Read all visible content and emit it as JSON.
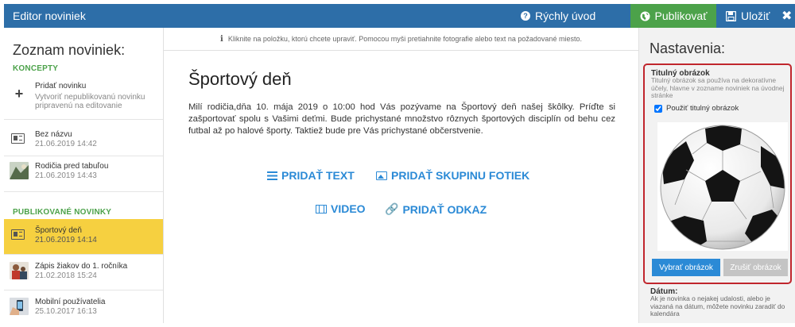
{
  "header": {
    "title": "Editor noviniek",
    "quick_start": "Rýchly úvod",
    "quick_start_icon": "?",
    "publish": "Publikovať",
    "save": "Uložiť",
    "close": "✖"
  },
  "sidebar": {
    "heading": "Zoznam noviniek:",
    "drafts_label": "KONCEPTY",
    "add_news": {
      "title": "Pridať novinku",
      "desc": "Vytvoriť nepublikovanú novinku pripravenú na editovanie"
    },
    "drafts": [
      {
        "title": "Bez názvu",
        "date": "21.06.2019 14:42",
        "icon": "news-icon"
      },
      {
        "title": "Rodičia pred tabuľou",
        "date": "21.06.2019 14:43",
        "icon": "photo-thumbnail"
      }
    ],
    "published_label": "PUBLIKOVANÉ NOVINKY",
    "published": [
      {
        "title": "Športový deň",
        "date": "21.06.2019 14:14",
        "icon": "news-icon",
        "active": true
      },
      {
        "title": "Zápis žiakov do 1. ročníka",
        "date": "21.02.2018 15:24",
        "icon": "photo-thumbnail"
      },
      {
        "title": "Mobilní používatelia",
        "date": "25.10.2017 16:13",
        "icon": "photo-thumbnail"
      }
    ]
  },
  "editor": {
    "hint_icon": "i",
    "hint": "Kliknite na položku, ktorú chcete upraviť. Pomocou myši pretiahnite fotografie alebo text na požadované miesto.",
    "title": "Športový deň",
    "body": "Milí rodičia,dňa 10. mája 2019 o 10:00 hod Vás pozývame na Športový deň našej škôlky. Príďte si zašportovať spolu s Vašimi deťmi. Bude prichystané množstvo rôznych športových disciplín od behu cez futbal až po halové športy. Taktiež bude pre Vás prichystané občerstvenie.",
    "add_text": "PRIDAŤ TEXT",
    "add_photos": "PRIDAŤ SKUPINU FOTIEK",
    "video": "VIDEO",
    "add_link": "PRIDAŤ ODKAZ",
    "link_icon": "🔗"
  },
  "settings": {
    "heading": "Nastavenia:",
    "cover_label": "Titulný obrázok",
    "cover_desc": "Titulný obrázok sa používa na dekoratívne účely, hlavne v zozname noviniek na úvodnej stránke",
    "use_cover": "Použiť titulný obrázok",
    "choose_image": "Vybrať obrázok",
    "cancel_image": "Zrušiť obrázok",
    "date_label": "Dátum:",
    "date_desc": "Ak je novinka o nejakej udalosti, alebo je viazaná na dátum, môžete novinku zaradiť do kalendára"
  },
  "colors": {
    "header_blue": "#2d6ea8",
    "publish_green": "#4ca24a",
    "active_yellow": "#f6d040",
    "accent_blue": "#2b8ad6",
    "highlight_red": "#c0262d"
  }
}
